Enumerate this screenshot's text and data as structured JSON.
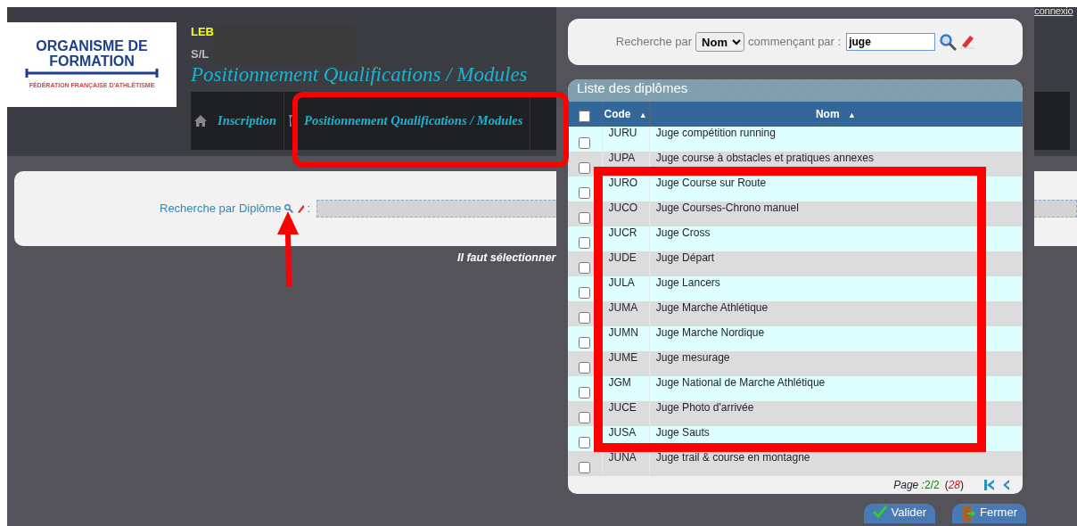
{
  "logo": {
    "line_1": "ORGANISME DE",
    "line_2": "FORMATION",
    "tagline": "FÉDÉRATION FRANÇAISE D'ATHLÉTISME"
  },
  "header": {
    "user_line": "LEB",
    "sub_line": "S/L",
    "title": "Positionnement Qualifications / Modules",
    "nav": [
      {
        "label": "Inscription"
      },
      {
        "label": "Positionnement Qualifications / Modules"
      }
    ]
  },
  "logout_link": "connexio",
  "search": {
    "label": "Recherche par Diplôme",
    "separator": ":"
  },
  "message": "Il faut sélectionner",
  "modal": {
    "search": {
      "label_by": "Recherche par",
      "by_value": "Nom",
      "label_start": "commençant par :",
      "value": "juge"
    },
    "list": {
      "title": "Liste des diplômes",
      "select_all": false,
      "columns": [
        {
          "label": "Code",
          "sort_mark": "▲"
        },
        {
          "label": "Nom",
          "sort_mark": "▲"
        }
      ],
      "rows": [
        {
          "code": "JURU",
          "name": "Juge compétition running",
          "checked": false
        },
        {
          "code": "JUPA",
          "name": "Juge course à obstacles et pratiques annexes",
          "checked": false
        },
        {
          "code": "JURO",
          "name": "Juge Course sur Route",
          "checked": false
        },
        {
          "code": "JUCO",
          "name": "Juge Courses-Chrono manuel",
          "checked": false
        },
        {
          "code": "JUCR",
          "name": "Juge Cross",
          "checked": false
        },
        {
          "code": "JUDE",
          "name": "Juge Départ",
          "checked": false
        },
        {
          "code": "JULA",
          "name": "Juge Lancers",
          "checked": false
        },
        {
          "code": "JUMA",
          "name": "Juge Marche Athlétique",
          "checked": false
        },
        {
          "code": "JUMN",
          "name": "Juge Marche Nordique",
          "checked": false
        },
        {
          "code": "JUME",
          "name": "Juge mesurage",
          "checked": false
        },
        {
          "code": "JGM",
          "name": "Juge National de Marche Athlétique",
          "checked": false
        },
        {
          "code": "JUCE",
          "name": "Juge Photo d'arrivée",
          "checked": false
        },
        {
          "code": "JUSA",
          "name": "Juge Sauts",
          "checked": false
        },
        {
          "code": "JUNA",
          "name": "Juge trail & course en montagne",
          "checked": false
        }
      ],
      "pager": {
        "label": "Page :",
        "current": "2/2",
        "total_open": "(",
        "total": "28",
        "total_close": ")"
      }
    },
    "buttons": [
      {
        "label": "Valider"
      },
      {
        "label": "Fermer"
      }
    ]
  },
  "annotations": [
    {
      "kind": "box"
    },
    {
      "kind": "box"
    },
    {
      "kind": "arrow"
    }
  ]
}
